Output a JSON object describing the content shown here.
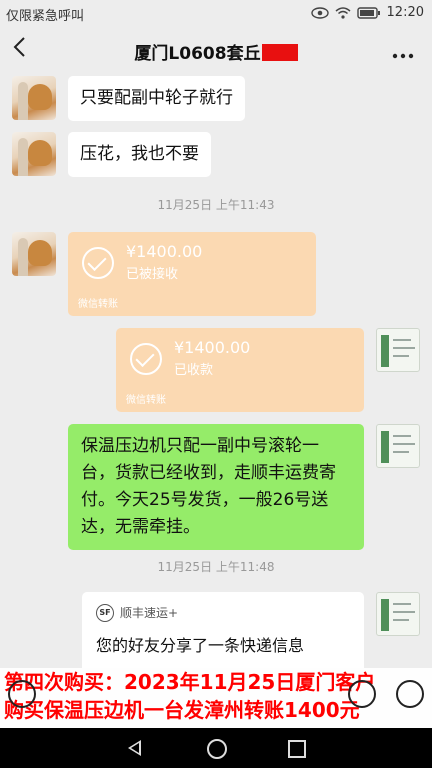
{
  "status_bar": {
    "carrier_text": "仅限紧急呼叫",
    "time": "12:20",
    "icons": [
      "eye-icon",
      "wifi-icon",
      "battery-icon"
    ]
  },
  "header": {
    "title": "厦门L0608套丘",
    "back_icon": "chevron-left-icon",
    "more_icon": "more-icon"
  },
  "messages": {
    "m1": "只要配副中轮子就行",
    "m2": "压花，我也不要",
    "time1": "11月25日 上午11:43",
    "t1": {
      "amount": "¥1400.00",
      "status": "已被接收",
      "foot": "微信转账"
    },
    "t2": {
      "amount": "¥1400.00",
      "status": "已收款",
      "foot": "微信转账"
    },
    "m3": "保温压边机只配一副中号滚轮一台，货款已经收到，走顺丰运费寄付。今天25号发货，一般26号送达，无需牵挂。",
    "time2": "11月25日 上午11:48",
    "express": {
      "brand": "顺丰速运+",
      "message": "您的好友分享了一条快递信息"
    }
  },
  "overlay": {
    "line1": "第四次购买：2023年11月25日厦门客户",
    "line2": "购买保温压边机一台发漳州转账1400元"
  },
  "colors": {
    "outgoing_bubble": "#95ec69",
    "transfer_card": "#fbd9b2",
    "overlay_text": "#ff0000",
    "redaction": "#e81010"
  }
}
